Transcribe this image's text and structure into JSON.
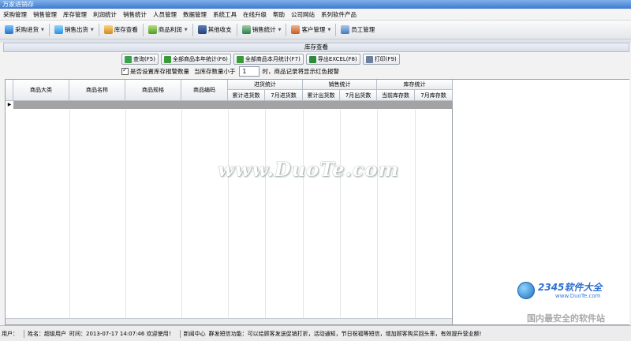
{
  "window": {
    "title": "万家进销存"
  },
  "menubar": {
    "items": [
      "采购管理",
      "销售管理",
      "库存管理",
      "利润统计",
      "销售统计",
      "人员管理",
      "数据管理",
      "系统工具",
      "在线升级",
      "帮助",
      "公司网站",
      "系列软件产品"
    ]
  },
  "toolbar": {
    "buttons": [
      {
        "label": "采购进货",
        "icon": "purchase-icon",
        "dropdown": true
      },
      {
        "label": "销售出货",
        "icon": "sales-icon",
        "dropdown": true
      },
      {
        "label": "库存查看",
        "icon": "inventory-icon",
        "dropdown": false
      },
      {
        "label": "商品利润",
        "icon": "profit-icon",
        "dropdown": true
      },
      {
        "label": "其他收支",
        "icon": "income-expense-icon",
        "dropdown": false
      },
      {
        "label": "销售统计",
        "icon": "chart-icon",
        "dropdown": true
      },
      {
        "label": "客户管理",
        "icon": "customer-icon",
        "dropdown": true
      },
      {
        "label": "员工管理",
        "icon": "staff-icon",
        "dropdown": false
      }
    ]
  },
  "page": {
    "title": "库存查看"
  },
  "actions": {
    "query": "查询(F5)",
    "year_stats": "全部商品本年统计(F6)",
    "month_stats": "全部商品本月统计(F7)",
    "export": "导出EXCEL(F8)",
    "print": "打印(F9)"
  },
  "options": {
    "alarm_checkbox_label": "是否设置库存报警数量",
    "alarm_checked": true,
    "threshold_prefix": "当库存数量小于",
    "threshold_value": "1",
    "threshold_suffix": "时，商品记录将显示红色报警"
  },
  "grid": {
    "columns": [
      "商品大类",
      "商品名称",
      "商品规格",
      "商品编码"
    ],
    "groups": [
      {
        "label": "进货统计",
        "subcolumns": [
          "累计进货数",
          "7月进货数"
        ]
      },
      {
        "label": "销售统计",
        "subcolumns": [
          "累计出货数",
          "7月出货数"
        ]
      },
      {
        "label": "库存统计",
        "subcolumns": [
          "当前库存数",
          "7月库存数"
        ]
      }
    ],
    "row_indicator": "▶"
  },
  "watermark": {
    "text": "www.DuoTe.com"
  },
  "logo": {
    "brand": "2345软件大全",
    "url": "www.DuoTe.com",
    "tagline": "国内最安全的软件站"
  },
  "statusbar": {
    "user_label": "用户：",
    "name": "姓名：超级用户",
    "time": "时间：2013-07-17 14:07:46 欢迎使用！",
    "news": "新闻中心",
    "message": "群发短信功能：可以给顾客发送促销打折，活动通知，节日祝福等短信，增加顾客购买回头率，有效提升营业额!"
  },
  "colors": {
    "titlebar": "#3c7bd0",
    "selected_row": "#a3a3a3",
    "logo_blue": "#2f6fd2"
  }
}
